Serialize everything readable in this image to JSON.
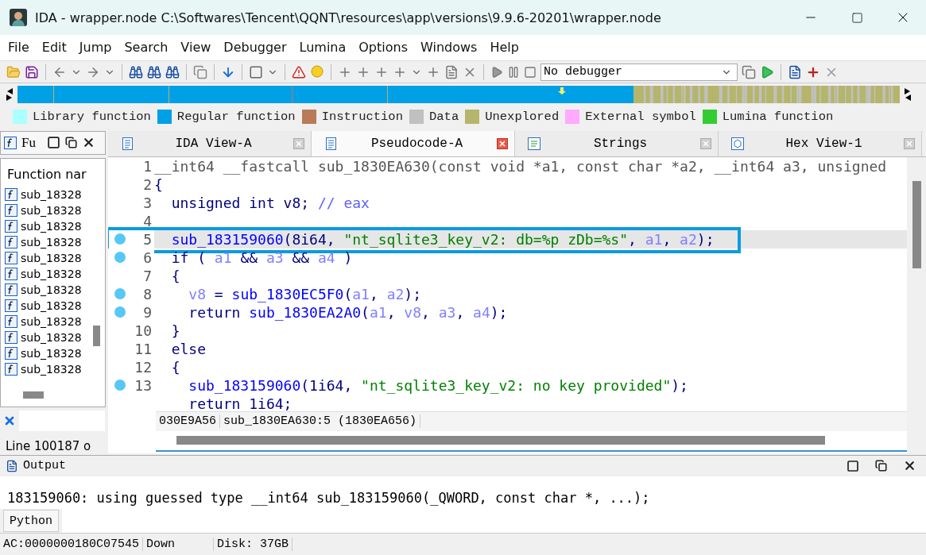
{
  "window": {
    "title": "IDA - wrapper.node C:\\Softwares\\Tencent\\QQNT\\resources\\app\\versions\\9.9.6-20201\\wrapper.node"
  },
  "menu": [
    "File",
    "Edit",
    "Jump",
    "Search",
    "View",
    "Debugger",
    "Lumina",
    "Options",
    "Windows",
    "Help"
  ],
  "toolbar": {
    "debugger_select": "No debugger"
  },
  "legend": [
    {
      "label": "Library function",
      "color": "#aaffff"
    },
    {
      "label": "Regular function",
      "color": "#00a0e6"
    },
    {
      "label": "Instruction",
      "color": "#b97a57"
    },
    {
      "label": "Data",
      "color": "#c0c0c0"
    },
    {
      "label": "Unexplored",
      "color": "#b5b56b"
    },
    {
      "label": "External symbol",
      "color": "#ffaaff"
    },
    {
      "label": "Lumina function",
      "color": "#33cc33"
    }
  ],
  "functions_panel": {
    "title": "Fu",
    "column": "Function nar",
    "items": [
      "sub_18328",
      "sub_18328",
      "sub_18328",
      "sub_18328",
      "sub_18328",
      "sub_18328",
      "sub_18328",
      "sub_18328",
      "sub_18328",
      "sub_18328",
      "sub_18328",
      "sub_18328"
    ],
    "footer": "Line 100187 o"
  },
  "tabs": [
    {
      "label": "IDA View-A",
      "selected": false,
      "kind": "disasm"
    },
    {
      "label": "Pseudocode-A",
      "selected": true,
      "kind": "pseudo"
    },
    {
      "label": "Strings",
      "selected": false,
      "kind": "strings"
    },
    {
      "label": "Hex View-1",
      "selected": false,
      "kind": "hex"
    }
  ],
  "code_lines": [
    {
      "number": "1",
      "breakpoint": false,
      "selected": false,
      "marked": false,
      "tokens": [
        {
          "kind": "proto",
          "text": "__int64 __fastcall sub_1830EA630(const void *a1, const char *a2, __int64 a3, unsigned"
        }
      ]
    },
    {
      "number": "2",
      "breakpoint": false,
      "selected": false,
      "marked": false,
      "tokens": [
        {
          "kind": "text",
          "text": "{"
        }
      ]
    },
    {
      "number": "3",
      "breakpoint": false,
      "selected": false,
      "marked": false,
      "tokens": [
        {
          "kind": "text",
          "text": "  unsigned int v8; "
        },
        {
          "kind": "comment",
          "text": "// eax"
        }
      ]
    },
    {
      "number": "4",
      "breakpoint": false,
      "selected": false,
      "marked": false
    },
    {
      "number": "5",
      "breakpoint": true,
      "selected": true,
      "marked": true,
      "tokens": [
        {
          "kind": "name",
          "text": "  sub_183159060"
        },
        {
          "kind": "text",
          "text": "(8i64, "
        },
        {
          "kind": "string",
          "text": "\"nt_sqlite3_key_v2: db=%p zDb=%s\""
        },
        {
          "kind": "text",
          "text": ", "
        },
        {
          "kind": "var",
          "text": "a1"
        },
        {
          "kind": "text",
          "text": ", "
        },
        {
          "kind": "var",
          "text": "a2"
        },
        {
          "kind": "text",
          "text": ");"
        }
      ]
    },
    {
      "number": "6",
      "breakpoint": true,
      "selected": false,
      "marked": false,
      "tokens": [
        {
          "kind": "text",
          "text": "  if ( "
        },
        {
          "kind": "var",
          "text": "a1"
        },
        {
          "kind": "text",
          "text": " && "
        },
        {
          "kind": "var",
          "text": "a3"
        },
        {
          "kind": "text",
          "text": " && "
        },
        {
          "kind": "var",
          "text": "a4"
        },
        {
          "kind": "text",
          "text": " )"
        }
      ]
    },
    {
      "number": "7",
      "breakpoint": false,
      "selected": false,
      "marked": false,
      "tokens": [
        {
          "kind": "text",
          "text": "  {"
        }
      ]
    },
    {
      "number": "8",
      "breakpoint": true,
      "selected": false,
      "marked": false,
      "tokens": [
        {
          "kind": "var",
          "text": "    v8"
        },
        {
          "kind": "text",
          "text": " = "
        },
        {
          "kind": "name",
          "text": "sub_1830EC5F0"
        },
        {
          "kind": "text",
          "text": "("
        },
        {
          "kind": "var",
          "text": "a1"
        },
        {
          "kind": "text",
          "text": ", "
        },
        {
          "kind": "var",
          "text": "a2"
        },
        {
          "kind": "text",
          "text": ");"
        }
      ]
    },
    {
      "number": "9",
      "breakpoint": true,
      "selected": false,
      "marked": false,
      "tokens": [
        {
          "kind": "text",
          "text": "    return "
        },
        {
          "kind": "name",
          "text": "sub_1830EA2A0"
        },
        {
          "kind": "text",
          "text": "("
        },
        {
          "kind": "var",
          "text": "a1"
        },
        {
          "kind": "text",
          "text": ", "
        },
        {
          "kind": "var",
          "text": "v8"
        },
        {
          "kind": "text",
          "text": ", "
        },
        {
          "kind": "var",
          "text": "a3"
        },
        {
          "kind": "text",
          "text": ", "
        },
        {
          "kind": "var",
          "text": "a4"
        },
        {
          "kind": "text",
          "text": ");"
        }
      ]
    },
    {
      "number": "10",
      "breakpoint": false,
      "selected": false,
      "marked": false,
      "tokens": [
        {
          "kind": "text",
          "text": "  }"
        }
      ]
    },
    {
      "number": "11",
      "breakpoint": false,
      "selected": false,
      "marked": false,
      "tokens": [
        {
          "kind": "text",
          "text": "  else"
        }
      ]
    },
    {
      "number": "12",
      "breakpoint": false,
      "selected": false,
      "marked": false,
      "tokens": [
        {
          "kind": "text",
          "text": "  {"
        }
      ]
    },
    {
      "number": "13",
      "breakpoint": true,
      "selected": false,
      "marked": false,
      "tokens": [
        {
          "kind": "name",
          "text": "    sub_183159060"
        },
        {
          "kind": "text",
          "text": "(1i64, "
        },
        {
          "kind": "string",
          "text": "\"nt_sqlite3_key_v2: no key provided\""
        },
        {
          "kind": "text",
          "text": ");"
        }
      ]
    },
    {
      "breakpoint": false,
      "selected": false,
      "marked": false,
      "tokens": [
        {
          "kind": "text",
          "text": "    return 1i64;"
        }
      ]
    }
  ],
  "code_status": [
    "030E9A56",
    "sub_1830EA630:5 (1830EA656)"
  ],
  "output": {
    "title": "Output",
    "lines": [
      "183159060: using guessed type __int64 sub_183159060(_QWORD, const char *, ...);"
    ],
    "interpreter": "Python"
  },
  "status_bar": [
    "AC:0000000180C07545",
    "Down",
    "Disk: 37GB"
  ]
}
